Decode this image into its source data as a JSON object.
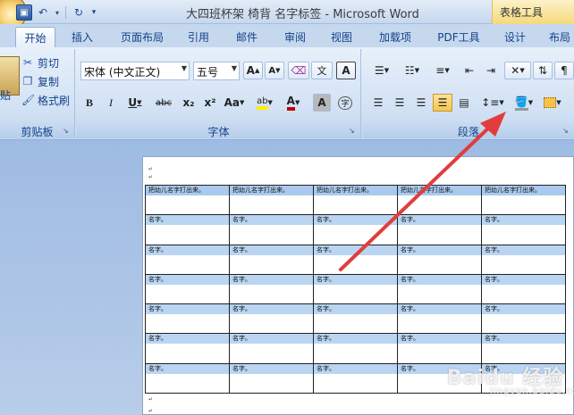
{
  "window": {
    "title": "大四班杯架 椅背 名字标签 - Microsoft Word",
    "context_tab_header": "表格工具"
  },
  "qat": {
    "save_label": "▣",
    "undo_label": "↶",
    "redo_label": "↻",
    "customize_label": "▾"
  },
  "tabs": {
    "home": "开始",
    "insert": "插入",
    "page_layout": "页面布局",
    "references": "引用",
    "mailings": "邮件",
    "review": "审阅",
    "view": "视图",
    "addins": "加载项",
    "pdf": "PDF工具",
    "design": "设计",
    "layout": "布局"
  },
  "clipboard": {
    "cut": "剪切",
    "copy": "复制",
    "format_painter": "格式刷",
    "paste_fragment": "贴",
    "group_label": "剪贴板"
  },
  "font": {
    "font_name": "宋体 (中文正文)",
    "font_size": "五号",
    "grow": "A",
    "shrink": "A",
    "bold": "B",
    "italic": "I",
    "underline": "U",
    "strike": "abc",
    "subscript": "x₂",
    "superscript": "x²",
    "change_case": "Aa",
    "highlight": "ab",
    "font_color": "A",
    "char_shading": "A",
    "enclose": "字",
    "phonetic": "文",
    "char_border": "A",
    "group_label": "字体"
  },
  "paragraph": {
    "group_label": "段落"
  },
  "table": {
    "header_text": "把幼儿名字打出来。",
    "cell_text": "名字。",
    "rows": 7,
    "cols": 5
  },
  "watermark": {
    "brand": "Baidu 经验",
    "sub": "jingyan.baidu.com"
  },
  "colors": {
    "annotation_arrow": "#e23c3c",
    "highlight": "#ffee00",
    "font_color": "#c00000",
    "cell_band": "#b9d5f2"
  }
}
